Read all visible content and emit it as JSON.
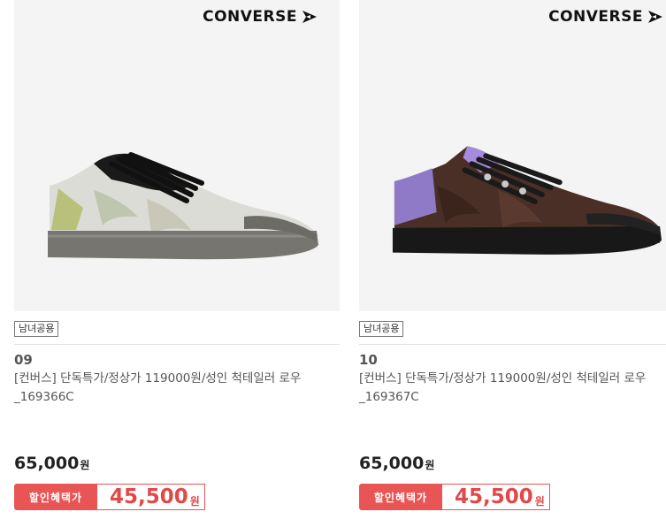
{
  "products": [
    {
      "brand": "CONVERSE",
      "badge": "남녀공용",
      "number": "09",
      "title": "[컨버스] 단독특가/정상가 119000원/성인 척테일러 로우_169366C",
      "price": "65,000",
      "price_unit": "원",
      "sale_label": "할인혜택가",
      "sale_price": "45,500",
      "sale_unit": "원",
      "image_icon": "camo-sneaker-grey-icon"
    },
    {
      "brand": "CONVERSE",
      "badge": "남녀공용",
      "number": "10",
      "title": "[컨버스] 단독특가/정상가 119000원/성인 척테일러 로우_169367C",
      "price": "65,000",
      "price_unit": "원",
      "sale_label": "할인혜택가",
      "sale_price": "45,500",
      "sale_unit": "원",
      "image_icon": "camo-sneaker-brown-icon"
    }
  ],
  "colors": {
    "accent": "#e95555",
    "thumb_bg": "#f4f4f4"
  }
}
